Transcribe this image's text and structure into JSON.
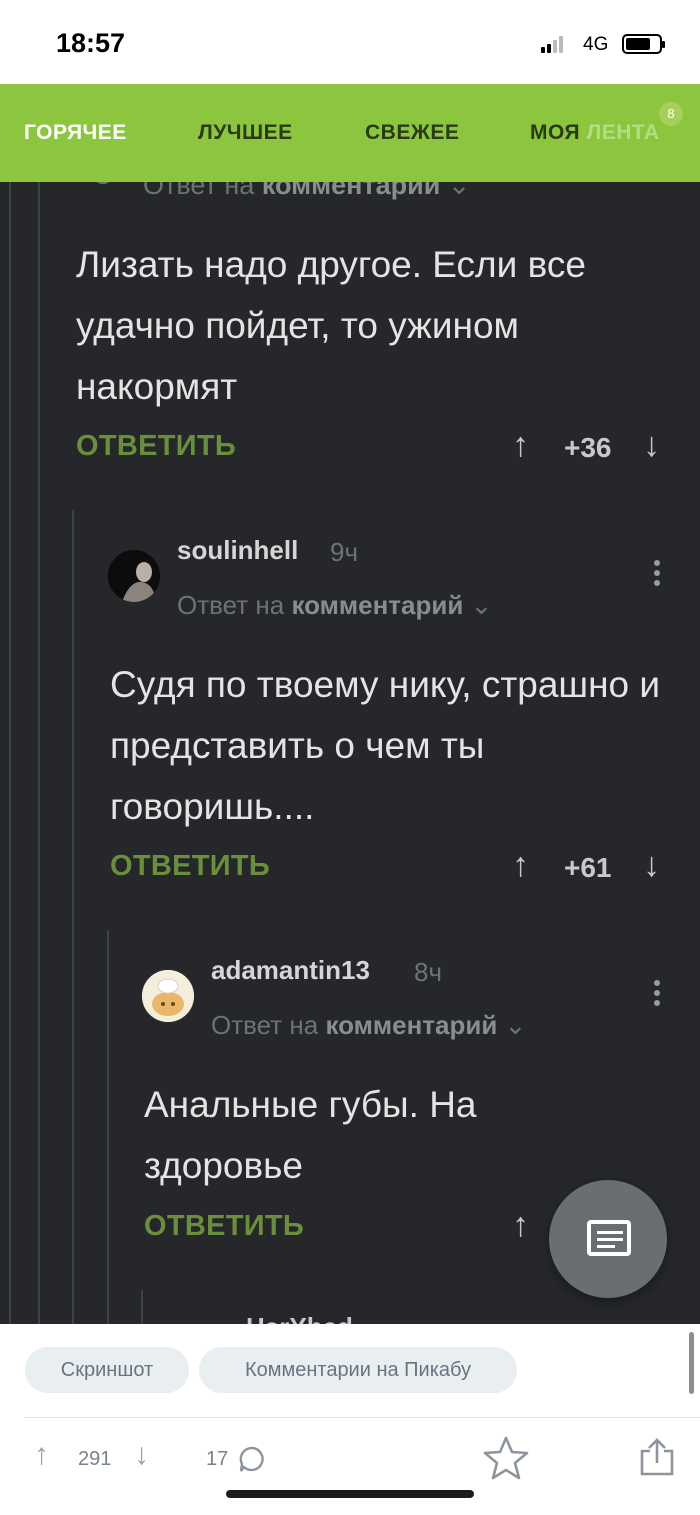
{
  "status_bar": {
    "time": "18:57",
    "network": "4G"
  },
  "tabs": [
    {
      "label": "ГОРЯЧЕЕ"
    },
    {
      "label": "ЛУЧШЕЕ"
    },
    {
      "label": "СВЕЖЕЕ"
    },
    {
      "label_main": "МОЯ ",
      "label_fade": "ЛЕНТА"
    }
  ],
  "tab_badge": "8",
  "clipped_header": {
    "reply_prefix": "Ответ на ",
    "reply_target": "комментарий"
  },
  "comments": [
    {
      "text": "Лизать надо другое. Если все удачно пойдет, то ужином накормят",
      "reply_label": "ОТВЕТИТЬ",
      "score": "+36"
    },
    {
      "user": "soulinhell",
      "ago": "9ч",
      "reply_prefix": "Ответ на ",
      "reply_target": "комментарий",
      "text": "Судя по твоему нику, страшно и представить о чем ты говоришь....",
      "reply_label": "ОТВЕТИТЬ",
      "score": "+61"
    },
    {
      "user": "adamantin13",
      "ago": "8ч",
      "reply_prefix": "Ответ на ",
      "reply_target": "комментарий",
      "text": "Анальные губы. На здоровье",
      "reply_label": "ОТВЕТИТЬ"
    }
  ],
  "partial_next_user": "HarYhed",
  "bottom": {
    "chip_1": "Скриншот",
    "chip_2": "Комментарии на Пикабу",
    "rating": "291",
    "comments_count": "17"
  },
  "colors": {
    "accent_green": "#8cc63f",
    "dark_bg": "#25272a",
    "reply_green": "#6a8f3a"
  }
}
